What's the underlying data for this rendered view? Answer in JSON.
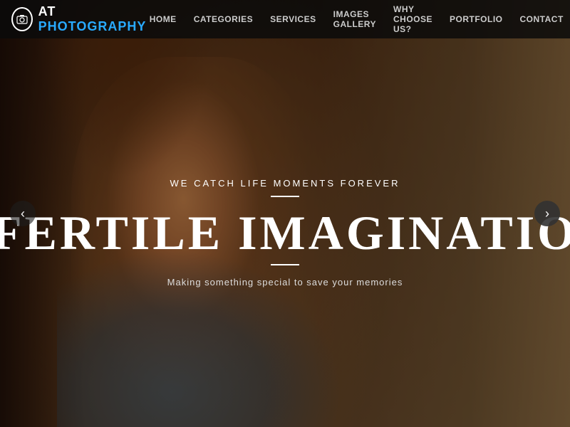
{
  "logo": {
    "at": "AT",
    "photography": "PHOTOGRAPHY"
  },
  "nav": {
    "items": [
      {
        "label": "HOME",
        "id": "home"
      },
      {
        "label": "CATEGORIES",
        "id": "categories"
      },
      {
        "label": "SERVICES",
        "id": "services"
      },
      {
        "label": "IMAGES GALLERY",
        "id": "images-gallery"
      },
      {
        "label": "WHY CHOOSE US?",
        "id": "why-choose-us"
      },
      {
        "label": "PORTFOLIO",
        "id": "portfolio"
      },
      {
        "label": "CONTACT",
        "id": "contact"
      }
    ]
  },
  "hero": {
    "tagline": "WE CATCH LIFE MOMENTS FOREVER",
    "title": "FERTILE IMAGINATIO",
    "subtitle": "Making something special to save your memories",
    "arrow_left": "‹",
    "arrow_right": "›"
  },
  "icons": {
    "camera": "📷",
    "hamburger": "≡"
  }
}
